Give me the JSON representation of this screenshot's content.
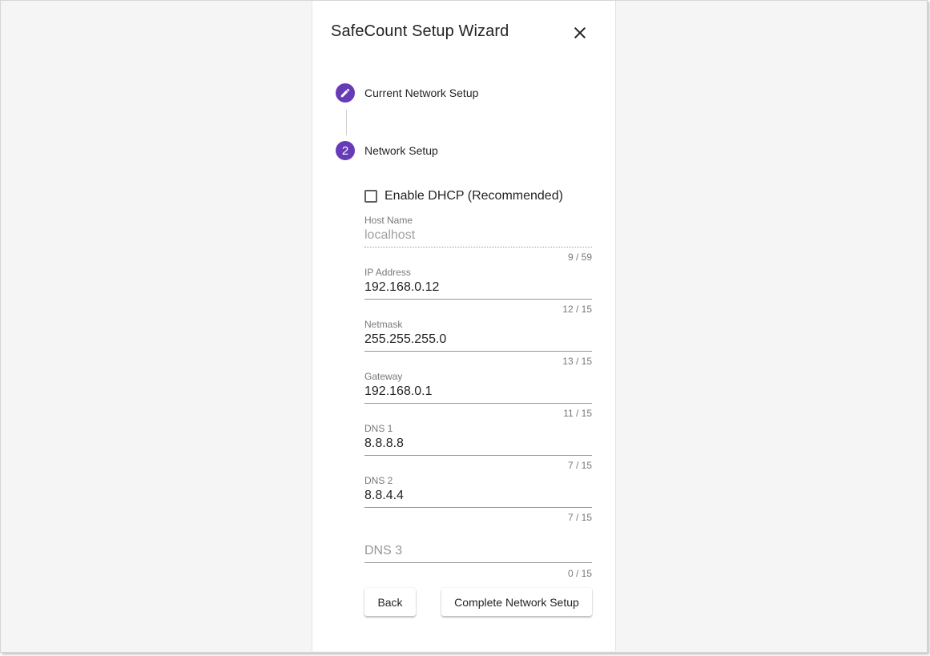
{
  "dialog": {
    "title": "SafeCount Setup Wizard",
    "close_icon": "close-icon"
  },
  "stepper": {
    "accent_color": "#673ab7",
    "steps": [
      {
        "label": "Current Network Setup",
        "icon": "pencil-icon",
        "state": "edit"
      },
      {
        "number": "2",
        "label": "Network Setup",
        "state": "active"
      }
    ]
  },
  "form": {
    "dhcp": {
      "label": "Enable DHCP (Recommended)",
      "checked": false
    },
    "fields": [
      {
        "label": "Host Name",
        "value": "localhost",
        "counter": "9 / 59",
        "disabled": true
      },
      {
        "label": "IP Address",
        "value": "192.168.0.12",
        "counter": "12 / 15"
      },
      {
        "label": "Netmask",
        "value": "255.255.255.0",
        "counter": "13 / 15"
      },
      {
        "label": "Gateway",
        "value": "192.168.0.1",
        "counter": "11 / 15"
      },
      {
        "label": "DNS 1",
        "value": "8.8.8.8",
        "counter": "7 / 15"
      },
      {
        "label": "DNS 2",
        "value": "8.8.4.4",
        "counter": "7 / 15"
      },
      {
        "placeholder": "DNS 3",
        "value": "",
        "counter": "0 / 15"
      }
    ]
  },
  "actions": {
    "back_label": "Back",
    "complete_label": "Complete Network Setup"
  }
}
